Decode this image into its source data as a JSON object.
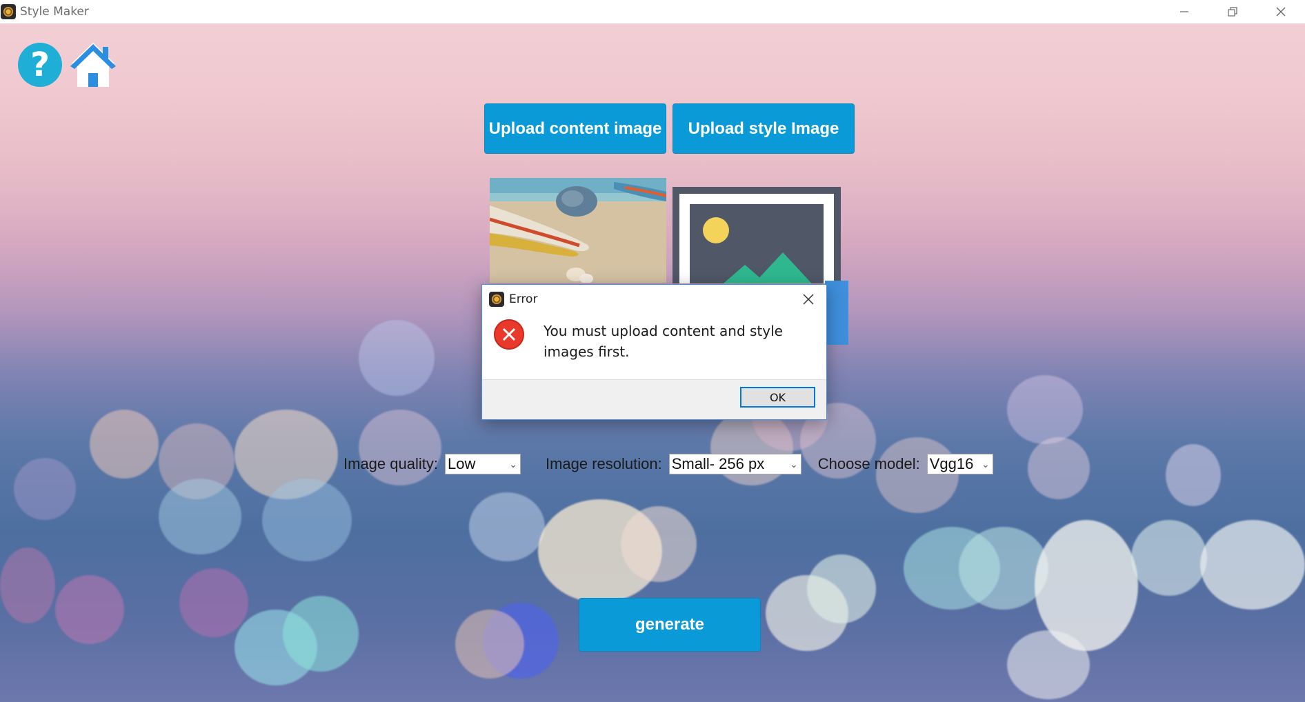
{
  "window": {
    "title": "Style Maker"
  },
  "toolbar": {
    "help_icon_glyph": "?",
    "help_icon": "help-icon",
    "home_icon": "home-icon"
  },
  "upload": {
    "content_label": "Upload content image",
    "style_label": "Upload style Image"
  },
  "settings": {
    "quality_label": "Image quality:",
    "quality_value": "Low",
    "resolution_label": "Image resolution:",
    "resolution_value": "Small- 256 px",
    "model_label": "Choose model:",
    "model_value": "Vgg16"
  },
  "generate": {
    "label": "generate"
  },
  "dialog": {
    "title": "Error",
    "message": "You must upload content and style images first.",
    "ok_label": "OK"
  },
  "colors": {
    "accent_blue": "#0a9ad8",
    "error_red": "#e8392b",
    "dialog_border": "#4a8edb"
  }
}
